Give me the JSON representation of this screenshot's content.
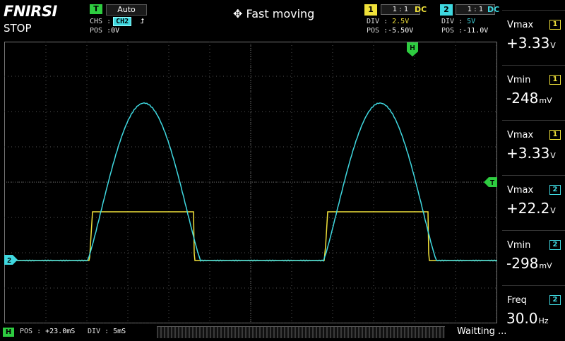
{
  "header": {
    "brand": "FNIRSI",
    "run_state": "STOP",
    "trigger": {
      "badge": "T",
      "mode": "Auto",
      "chs_label": "CHS :",
      "chs_value": "CH2",
      "edge_symbol": "⮥",
      "pos_label": "POS :",
      "pos_value": "0V"
    },
    "hint": "Fast moving",
    "ch1": {
      "num": "1",
      "probe": "1 : 1",
      "coupling": "DC",
      "div_label": "DIV :",
      "div_value": "2.5V",
      "pos_label": "POS :",
      "pos_value": "-5.50V"
    },
    "ch2": {
      "num": "2",
      "probe": "1 : 1",
      "coupling": "DC",
      "div_label": "DIV :",
      "div_value": "5V",
      "pos_label": "POS :",
      "pos_value": "-11.0V"
    }
  },
  "markers": {
    "h": "H",
    "t": "T",
    "ch2": "2"
  },
  "measurements": [
    {
      "label": "Vmax",
      "ch": "1",
      "value": "+3.33",
      "unit": "V"
    },
    {
      "label": "Vmin",
      "ch": "1",
      "value": "-248",
      "unit": "mV"
    },
    {
      "label": "Vmax",
      "ch": "1",
      "value": "+3.33",
      "unit": "V"
    },
    {
      "label": "Vmax",
      "ch": "2",
      "value": "+22.2",
      "unit": "V"
    },
    {
      "label": "Vmin",
      "ch": "2",
      "value": "-298",
      "unit": "mV"
    },
    {
      "label": "Freq",
      "ch": "2",
      "value": "30.0",
      "unit": "Hz"
    }
  ],
  "footer": {
    "h_badge": "H",
    "pos_label": "POS : ",
    "pos_value": "+23.0mS",
    "div_label": "DIV : ",
    "div_value": "5mS",
    "status": "Waitting ..."
  },
  "colors": {
    "ch1": "#f0e13a",
    "ch2": "#3fd8e0",
    "trigger": "#2ecc40",
    "grid": "#555555"
  }
}
